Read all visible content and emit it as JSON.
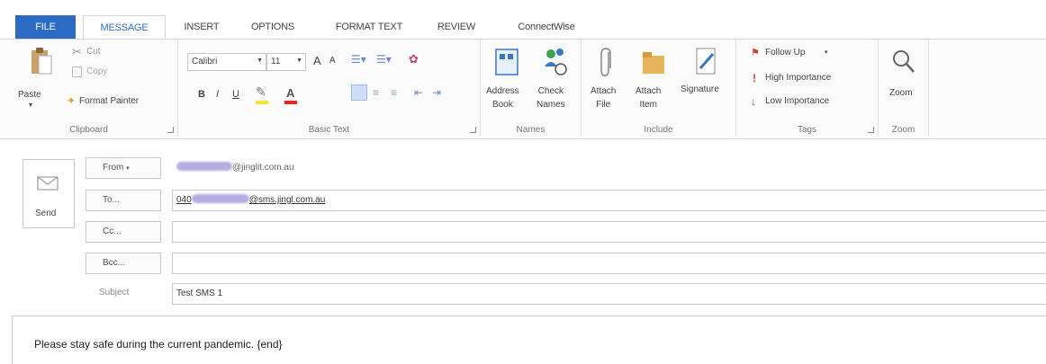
{
  "tabs": [
    "FILE",
    "MESSAGE",
    "INSERT",
    "OPTIONS",
    "FORMAT TEXT",
    "REVIEW",
    "ConnectWise"
  ],
  "clipboard": {
    "paste": "Paste",
    "cut": "Cut",
    "copy": "Copy",
    "format_painter": "Format Painter",
    "label": "Clipboard"
  },
  "basic_text": {
    "font_name": "Calibri",
    "font_size": "11",
    "bold": "B",
    "italic": "I",
    "underline": "U",
    "grow_font": "A",
    "shrink_font": "A",
    "label": "Basic Text"
  },
  "names": {
    "address_book": "Address\nBook",
    "check_names": "Check\nNames",
    "label": "Names"
  },
  "include": {
    "attach_file": "Attach\nFile",
    "attach_item": "Attach\nItem",
    "signature": "Signature",
    "label": "Include"
  },
  "tags": {
    "follow_up": "Follow Up",
    "high_importance": "High Importance",
    "low_importance": "Low Importance",
    "label": "Tags"
  },
  "zoom": {
    "zoom": "Zoom",
    "label": "Zoom"
  },
  "form": {
    "send": "Send",
    "from_label": "From",
    "from_value": "@jinglit.com.au",
    "to_label": "To...",
    "to_prefix": "040",
    "to_suffix": "@sms.jingl.com.au",
    "cc_label": "Cc...",
    "bcc_label": "Bcc...",
    "subject_label": "Subject",
    "subject_value": "Test SMS 1"
  },
  "body": {
    "text": "Please stay safe during the current pandemic. {end}"
  },
  "colors": {
    "accent": "#2b6bc4",
    "follow_up_flag": "#d43a2f",
    "high_importance": "#d43a2f",
    "low_importance": "#2b6bc4"
  }
}
